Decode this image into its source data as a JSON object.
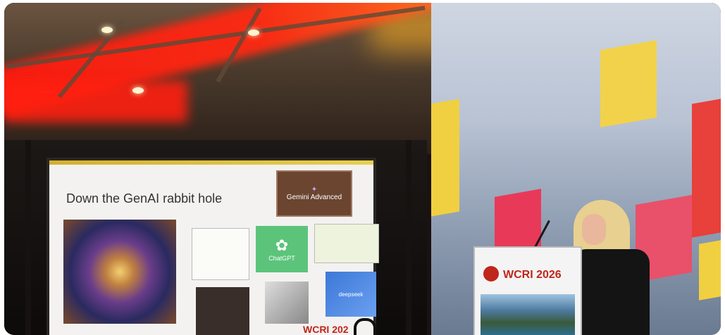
{
  "slide": {
    "title": "Down the GenAI rabbit hole",
    "gemini_label": "Gemini Advanced",
    "chatgpt_label": "ChatGPT",
    "deepseek_label": "deepseek"
  },
  "podium": {
    "event": "WCRI 2026"
  },
  "bottom_sign": {
    "text": "WCRI 202"
  },
  "colors": {
    "red_light": "#ff2010",
    "stage_accent": "#c0261c"
  }
}
